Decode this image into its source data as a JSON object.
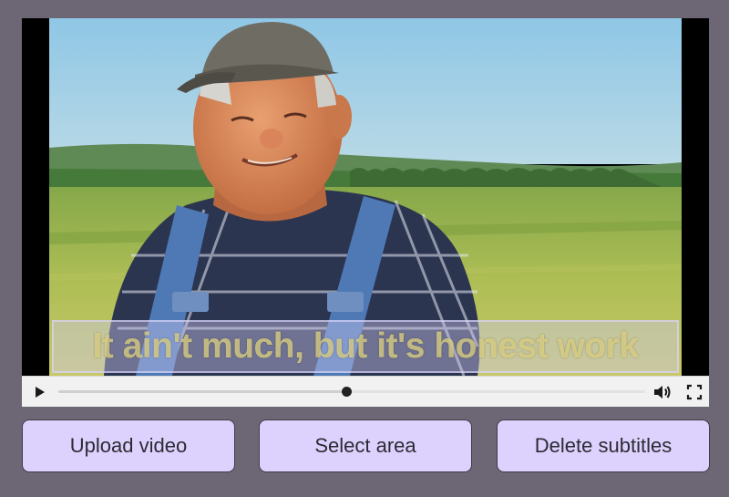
{
  "video": {
    "subtitle": "It ain't much, but it's honest work",
    "progress_fraction": 0.49
  },
  "controls": {
    "play_icon": "play-icon",
    "volume_icon": "volume-icon",
    "fullscreen_icon": "fullscreen-icon"
  },
  "actions": {
    "upload_label": "Upload video",
    "select_label": "Select area",
    "delete_label": "Delete subtitles"
  },
  "colors": {
    "page_background": "#6d6775",
    "button_fill": "#dcd2fd",
    "subtitle_text": "#e8dc8c"
  }
}
